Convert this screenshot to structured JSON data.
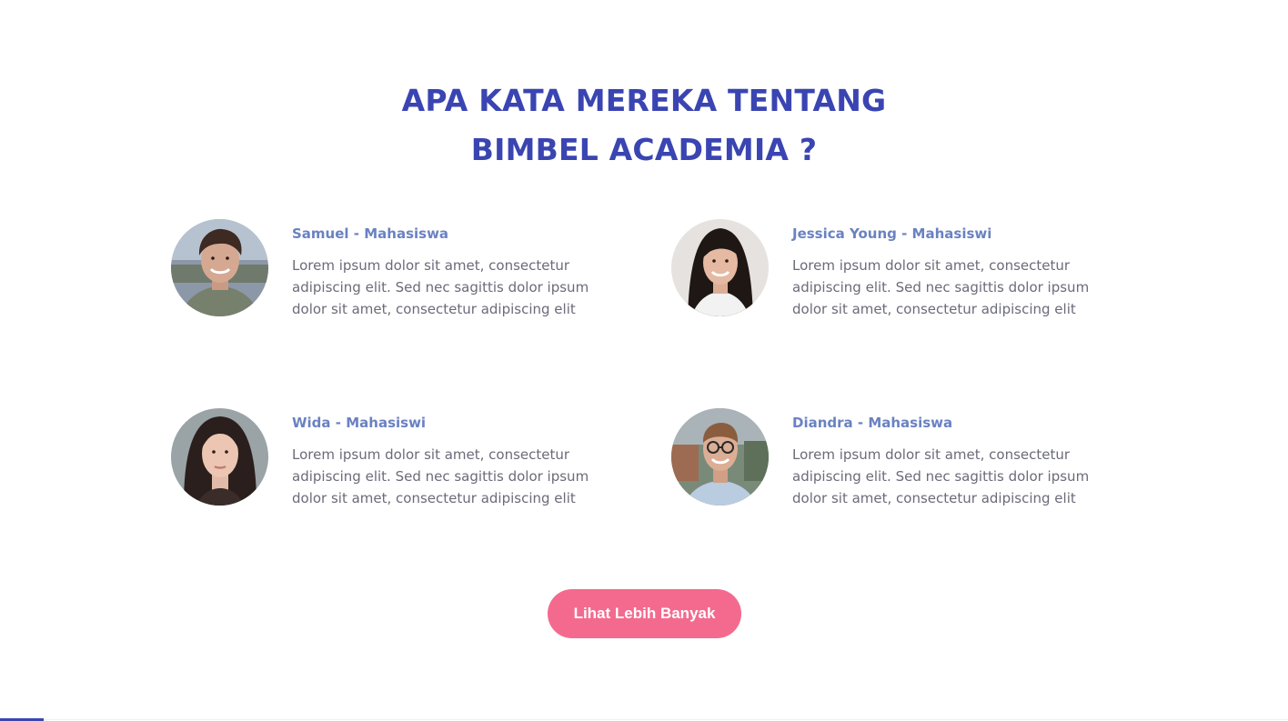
{
  "section": {
    "title_line1": "APA KATA MEREKA TENTANG",
    "title_line2": "BIMBEL ACADEMIA ?"
  },
  "testimonials": [
    {
      "name": "Samuel - Mahasiswa",
      "quote": "Lorem ipsum dolor sit amet, consectetur adipiscing elit. Sed nec sagittis dolor ipsum dolor sit amet, consectetur adipiscing elit",
      "avatar_alt": "photo of Samuel"
    },
    {
      "name": "Jessica Young - Mahasiswi",
      "quote": "Lorem ipsum dolor sit amet, consectetur adipiscing elit. Sed nec sagittis dolor ipsum dolor sit amet, consectetur adipiscing elit",
      "avatar_alt": "photo of Jessica Young"
    },
    {
      "name": "Wida - Mahasiswi",
      "quote": "Lorem ipsum dolor sit amet, consectetur adipiscing elit. Sed nec sagittis dolor ipsum dolor sit amet, consectetur adipiscing elit",
      "avatar_alt": "photo of Wida"
    },
    {
      "name": "Diandra - Mahasiswa",
      "quote": "Lorem ipsum dolor sit amet, consectetur adipiscing elit. Sed nec sagittis dolor ipsum dolor sit amet, consectetur adipiscing elit",
      "avatar_alt": "photo of Diandra"
    }
  ],
  "cta": {
    "label": "Lihat Lebih Banyak"
  },
  "colors": {
    "title": "#3a45b2",
    "name": "#6a82c2",
    "body_text": "#6b6b7a",
    "button_bg": "#f46a8e",
    "button_text": "#ffffff"
  }
}
